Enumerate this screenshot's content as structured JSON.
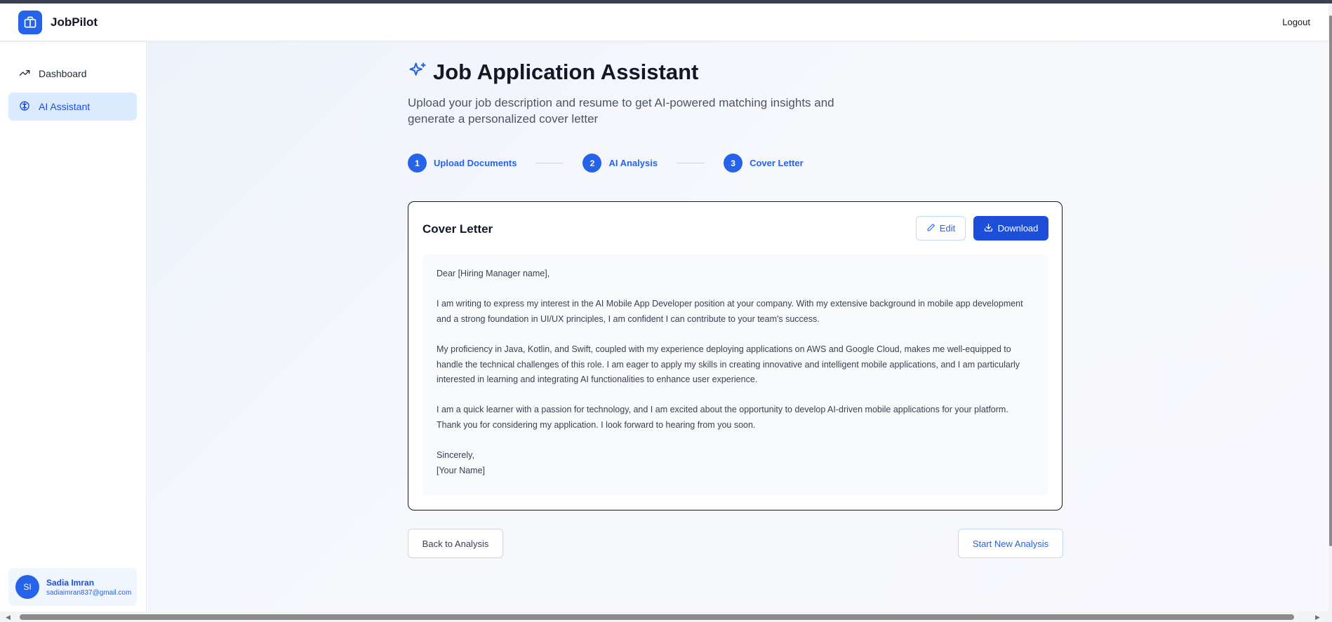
{
  "app": {
    "name": "JobPilot",
    "logout_label": "Logout"
  },
  "sidebar": {
    "items": [
      {
        "label": "Dashboard",
        "icon": "trending-up-icon",
        "active": false
      },
      {
        "label": "AI Assistant",
        "icon": "brain-icon",
        "active": true
      }
    ],
    "user": {
      "initials": "SI",
      "name": "Sadia Imran",
      "email": "sadiaimran837@gmail.com"
    }
  },
  "page": {
    "title": "Job Application Assistant",
    "title_icon": "sparkles-icon",
    "subtitle": "Upload your job description and resume to get AI-powered matching insights and generate a personalized cover letter"
  },
  "steps": [
    {
      "number": "1",
      "label": "Upload Documents"
    },
    {
      "number": "2",
      "label": "AI Analysis"
    },
    {
      "number": "3",
      "label": "Cover Letter"
    }
  ],
  "cover_letter": {
    "title": "Cover Letter",
    "edit_label": "Edit",
    "download_label": "Download",
    "greeting": "Dear [Hiring Manager name],",
    "paragraphs": [
      "I am writing to express my interest in the AI Mobile App Developer position at your company. With my extensive background in mobile app development and a strong foundation in UI/UX principles, I am confident I can contribute to your team's success.",
      "My proficiency in Java, Kotlin, and Swift, coupled with my experience deploying applications on AWS and Google Cloud, makes me well-equipped to handle the technical challenges of this role. I am eager to apply my skills in creating innovative and intelligent mobile applications, and I am particularly interested in learning and integrating AI functionalities to enhance user experience.",
      "I am a quick learner with a passion for technology, and I am excited about the opportunity to develop AI-driven mobile applications for your platform. Thank you for considering my application. I look forward to hearing from you soon."
    ],
    "closing": "Sincerely,",
    "signature": "[Your Name]"
  },
  "actions": {
    "back_label": "Back to Analysis",
    "new_label": "Start New Analysis"
  },
  "colors": {
    "accent": "#2563eb",
    "active_bg": "#dbeafe"
  }
}
